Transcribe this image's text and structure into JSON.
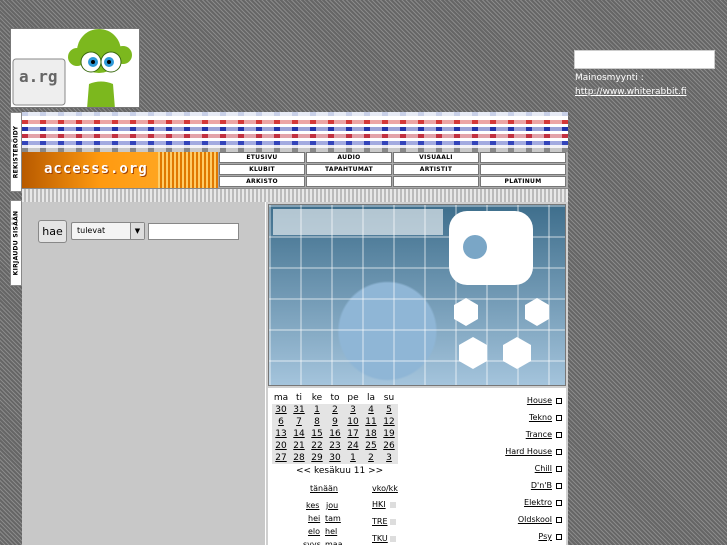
{
  "logo": {
    "text": "a.rg"
  },
  "sidebar": {
    "register_tab": "REKISTERÖIDY",
    "login_tab": "KIRJAUDU SISÄÄN"
  },
  "ad": {
    "label": "Mainosmyynti :",
    "link": "http://www.whiterabbit.fi"
  },
  "banner": {
    "text": "accesss.org"
  },
  "nav": {
    "items": [
      "ETUSIVU",
      "AUDIO",
      "VISUAALI",
      "",
      "KLUBIT",
      "TAPAHTUMAT",
      "ARTISTIT",
      "",
      "ARKISTO",
      "",
      "",
      "PLATINUM"
    ]
  },
  "search": {
    "button": "hae",
    "select_value": "tulevat",
    "arrow": "▼",
    "input_value": ""
  },
  "calendar": {
    "weekdays": [
      "ma",
      "ti",
      "ke",
      "to",
      "pe",
      "la",
      "su"
    ],
    "weeks": [
      [
        "30",
        "31",
        "1",
        "2",
        "3",
        "4",
        "5"
      ],
      [
        "6",
        "7",
        "8",
        "9",
        "10",
        "11",
        "12"
      ],
      [
        "13",
        "14",
        "15",
        "16",
        "17",
        "18",
        "19"
      ],
      [
        "20",
        "21",
        "22",
        "23",
        "24",
        "25",
        "26"
      ],
      [
        "27",
        "28",
        "29",
        "30",
        "1",
        "2",
        "3"
      ]
    ],
    "prev": "<<",
    "month": "kesäkuu 11",
    "next": ">>",
    "today": "tänään",
    "week_month": "vko/kk",
    "months": [
      "kes",
      "jou",
      "hei",
      "tam",
      "elo",
      "hel",
      "syys",
      "maa"
    ],
    "cities": [
      "HKI",
      "TRE",
      "TKU"
    ]
  },
  "genres": [
    "House",
    "Tekno",
    "Trance",
    "Hard House",
    "Chill",
    "D'n'B",
    "Elektro",
    "Oldskool",
    "Psy"
  ],
  "colors": {
    "banner": "#ff9a10",
    "stripe_red": "#d43838",
    "stripe_blue": "#2233aa"
  }
}
